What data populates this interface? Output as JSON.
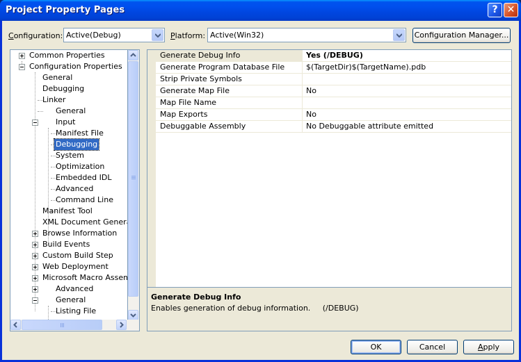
{
  "window": {
    "title": "Project Property Pages",
    "help_glyph": "?",
    "close_glyph": "✕"
  },
  "header": {
    "configuration_label_accel": "C",
    "configuration_label_rest": "onfiguration:",
    "configuration_value": "Active(Debug)",
    "platform_label_accel": "P",
    "platform_label_rest": "latform:",
    "platform_value": "Active(Win32)",
    "config_manager_label": "Configuration Manager..."
  },
  "tree": {
    "items": [
      {
        "label": "Common Properties"
      },
      {
        "label": "Configuration Properties"
      },
      {
        "label": "General"
      },
      {
        "label": "Debugging"
      },
      {
        "label": "Linker"
      },
      {
        "label": "General"
      },
      {
        "label": "Input"
      },
      {
        "label": "Manifest File"
      },
      {
        "label": "Debugging",
        "selected": true
      },
      {
        "label": "System"
      },
      {
        "label": "Optimization"
      },
      {
        "label": "Embedded IDL"
      },
      {
        "label": "Advanced"
      },
      {
        "label": "Command Line"
      },
      {
        "label": "Manifest Tool"
      },
      {
        "label": "XML Document Generator"
      },
      {
        "label": "Browse Information"
      },
      {
        "label": "Build Events"
      },
      {
        "label": "Custom Build Step"
      },
      {
        "label": "Web Deployment"
      },
      {
        "label": "Microsoft Macro Assembler"
      },
      {
        "label": "Advanced"
      },
      {
        "label": "General"
      },
      {
        "label": "Listing File"
      }
    ]
  },
  "properties": {
    "rows": [
      {
        "name": "Generate Debug Info",
        "value": "Yes (/DEBUG)",
        "selected": true
      },
      {
        "name": "Generate Program Database File",
        "value": "$(TargetDir)$(TargetName).pdb"
      },
      {
        "name": "Strip Private Symbols",
        "value": ""
      },
      {
        "name": "Generate Map File",
        "value": "No"
      },
      {
        "name": "Map File Name",
        "value": ""
      },
      {
        "name": "Map Exports",
        "value": "No"
      },
      {
        "name": "Debuggable Assembly",
        "value": "No Debuggable attribute emitted"
      }
    ]
  },
  "description": {
    "title": "Generate Debug Info",
    "text": "Enables generation of debug information.     (/DEBUG)"
  },
  "footer": {
    "ok_label": "OK",
    "cancel_label": "Cancel",
    "apply_label_accel": "A",
    "apply_label_rest": "pply"
  }
}
